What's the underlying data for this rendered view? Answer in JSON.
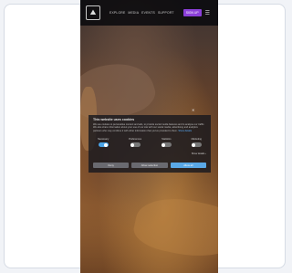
{
  "navbar": {
    "logo_glyph": "⛰",
    "links": [
      "EXPLORE",
      "MEDIA",
      "EVENTS",
      "SUPPORT"
    ],
    "cta_label": "SIGN UP",
    "menu_glyph": "☰"
  },
  "dialog": {
    "close_glyph": "✕",
    "title": "This website uses cookies",
    "body": "We use cookies to personalise content and ads, to provide social media features and to analyse our traffic. We also share information about your use of our site with our social media, advertising and analytics partners who may combine it with other information that you've provided to them.",
    "link": "Show details",
    "toggles": [
      {
        "label": "Necessary",
        "on": true
      },
      {
        "label": "Preferences",
        "on": false
      },
      {
        "label": "Statistics",
        "on": false
      },
      {
        "label": "Marketing",
        "on": false
      }
    ],
    "details_label": "Show details ›",
    "buttons": {
      "deny": "Deny",
      "allow_selection": "Allow selection",
      "allow_all": "Allow all"
    }
  }
}
